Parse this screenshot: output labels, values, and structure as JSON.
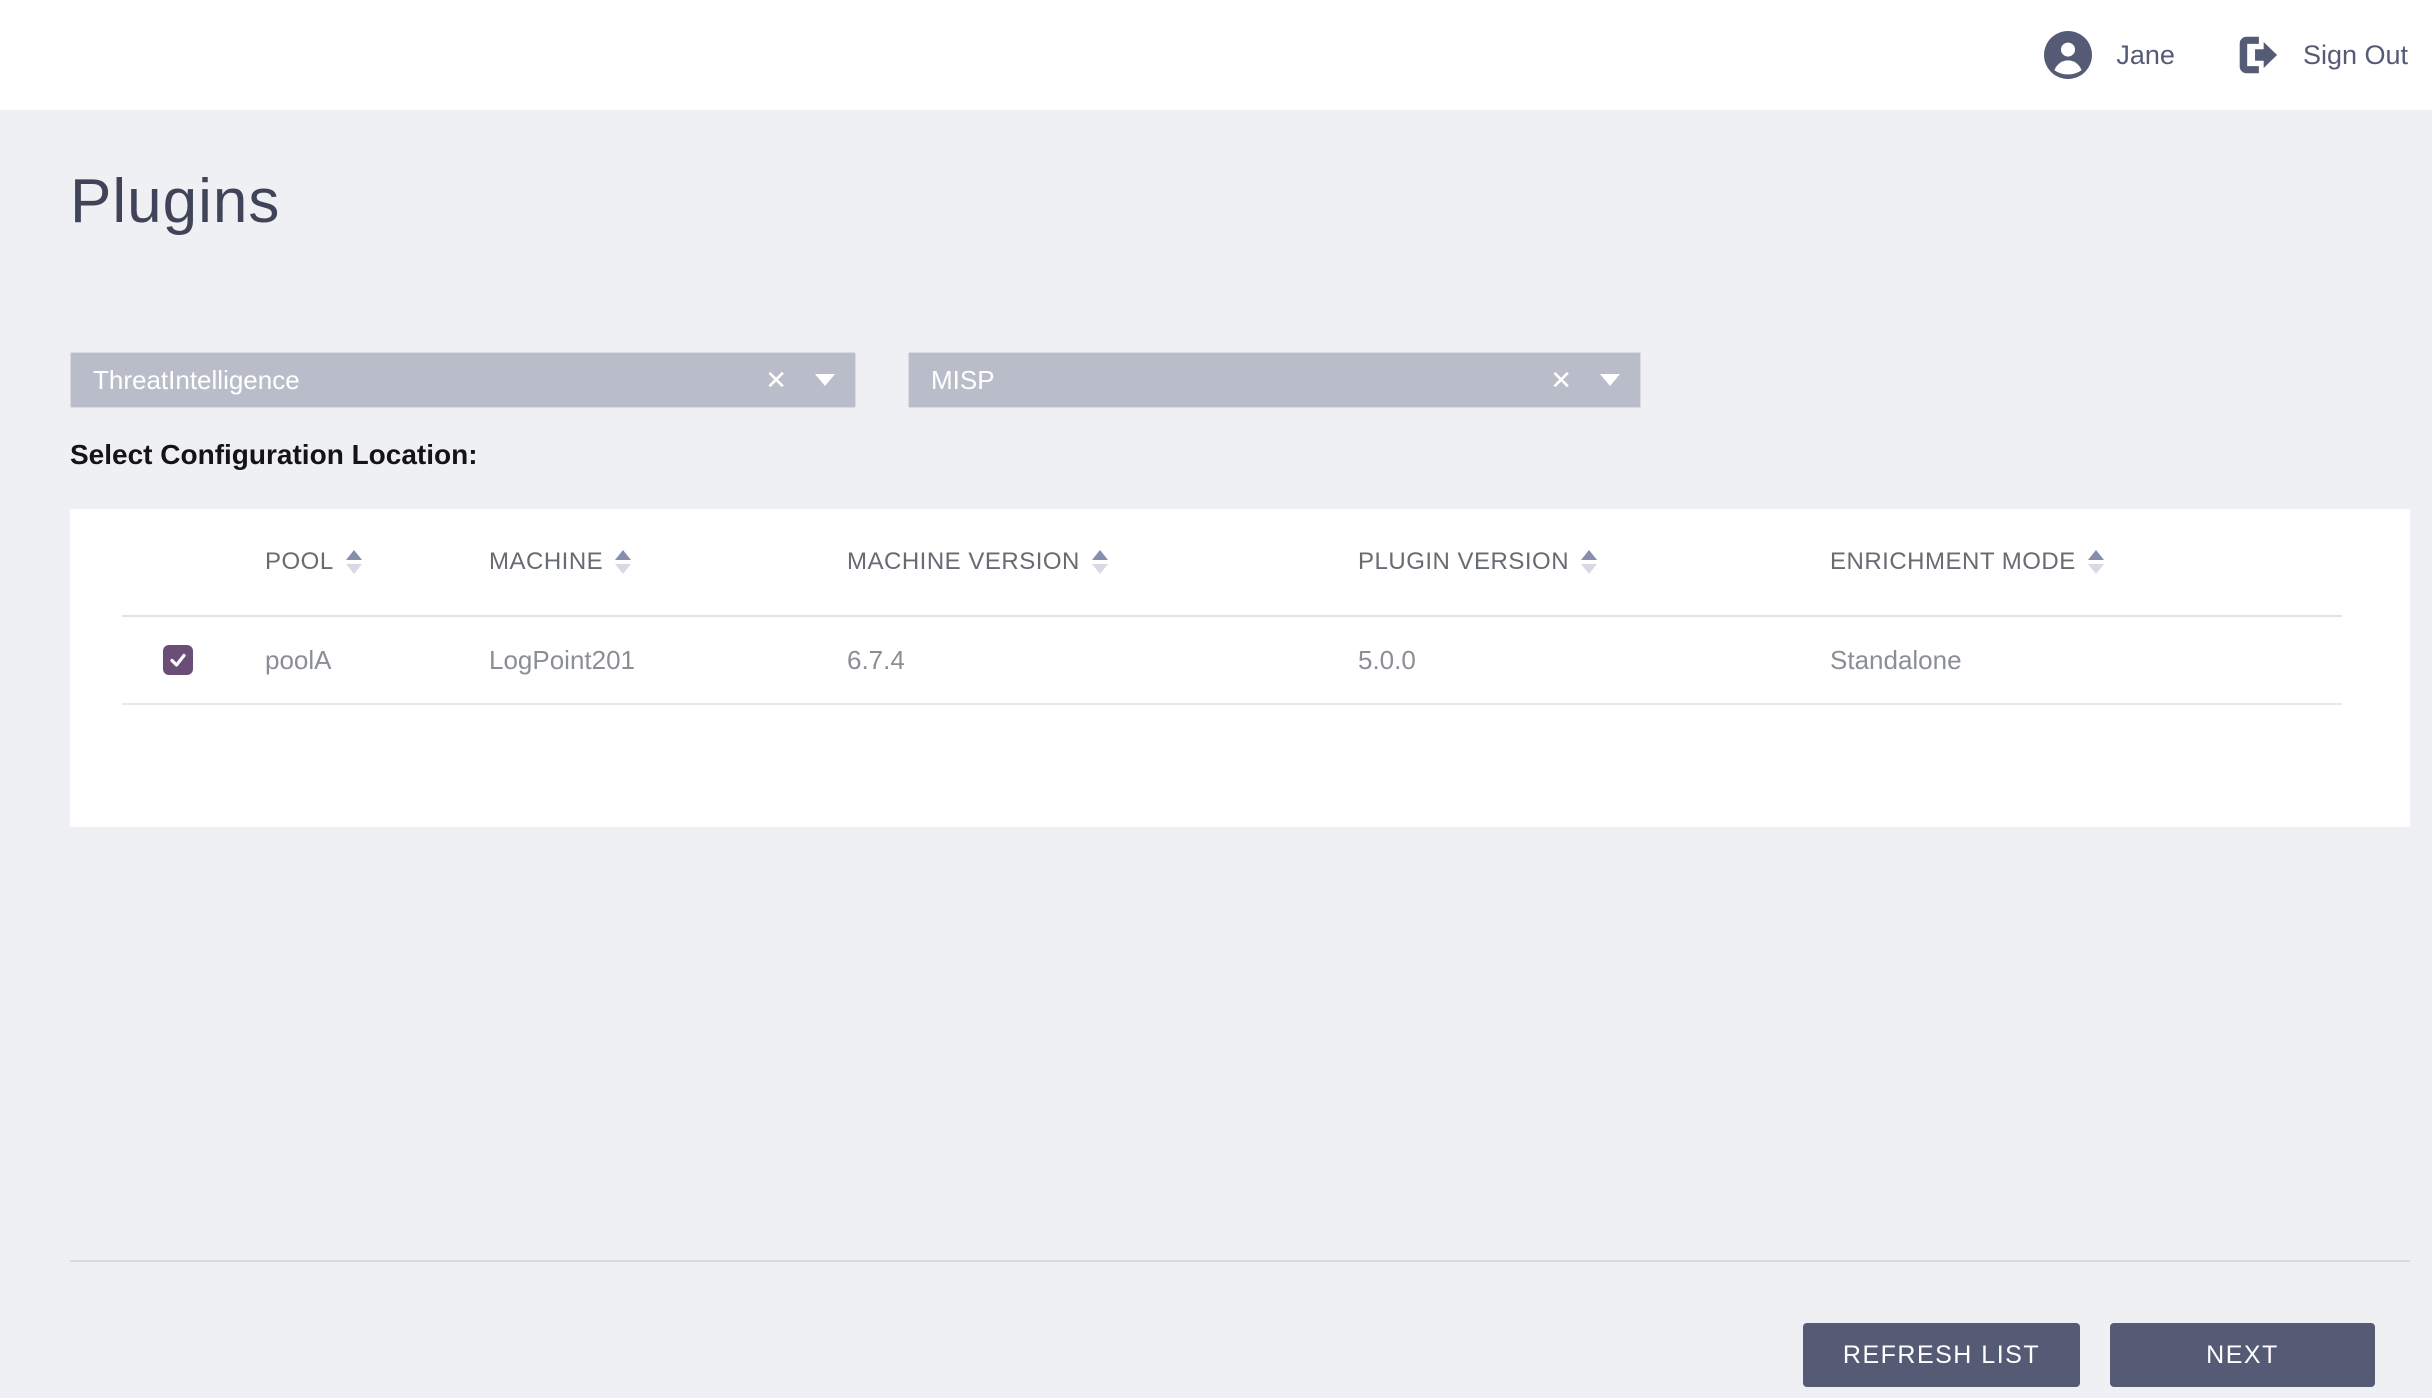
{
  "topbar": {
    "user_name": "Jane",
    "sign_out_label": "Sign Out"
  },
  "page": {
    "title": "Plugins",
    "section_label": "Select Configuration Location:"
  },
  "filters": {
    "plugin_type": {
      "value": "ThreatIntelligence"
    },
    "plugin_name": {
      "value": "MISP"
    }
  },
  "icons": {
    "clear": "✕"
  },
  "table": {
    "columns": [
      "POOL",
      "MACHINE",
      "MACHINE VERSION",
      "PLUGIN VERSION",
      "ENRICHMENT MODE"
    ],
    "rows": [
      {
        "selected": true,
        "pool": "poolA",
        "machine": "LogPoint201",
        "machine_version": "6.7.4",
        "plugin_version": "5.0.0",
        "enrichment_mode": "Standalone"
      }
    ]
  },
  "actions": {
    "refresh_label": "REFRESH LIST",
    "next_label": "NEXT"
  },
  "colors": {
    "background": "#eef0f3",
    "topbar": "#ffffff",
    "dropdown_fill": "#b9bdca",
    "checkbox_accent": "#6b4e78",
    "button_fill": "#565b75",
    "heading_text": "#3f4458"
  }
}
